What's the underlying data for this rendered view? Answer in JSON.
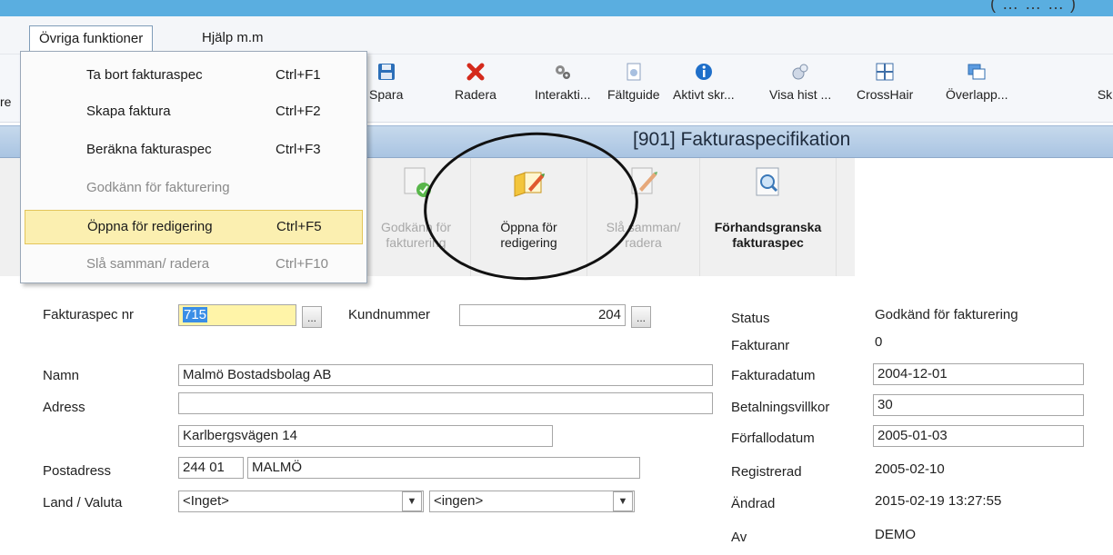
{
  "window_title": "[901]  Fakturaspecifikation",
  "titlebar_fragment": "( … … … )",
  "menubar": {
    "items": [
      "Övriga funktioner",
      "Hjälp m.m"
    ]
  },
  "dropdown": {
    "items": [
      {
        "label": "Ta bort fakturaspec",
        "shortcut": "Ctrl+F1"
      },
      {
        "label": "Skapa faktura",
        "shortcut": "Ctrl+F2"
      },
      {
        "label": "Beräkna fakturaspec",
        "shortcut": "Ctrl+F3"
      },
      {
        "label": "Godkänn för fakturering",
        "shortcut": ""
      },
      {
        "label": "Öppna för redigering",
        "shortcut": "Ctrl+F5"
      },
      {
        "label": "Slå samman/ radera",
        "shortcut": "Ctrl+F10"
      }
    ]
  },
  "toolbar": {
    "items": [
      {
        "label": "Spara",
        "icon": "floppy-save-icon"
      },
      {
        "label": "Radera",
        "icon": "red-x-delete-icon"
      },
      {
        "label": "Interakti...",
        "icon": "gears-icon"
      },
      {
        "label": "Fältguide",
        "icon": "document-guide-icon"
      },
      {
        "label": "Aktivt skr...",
        "icon": "info-icon"
      },
      {
        "label": "Visa hist ...",
        "icon": "history-icon"
      },
      {
        "label": "CrossHair",
        "icon": "crosshair-grid-icon"
      },
      {
        "label": "Överlapp...",
        "icon": "overlap-windows-icon"
      },
      {
        "label": "Sk",
        "icon": "generic-icon"
      }
    ],
    "left_fragment": "re"
  },
  "actions": [
    {
      "label_1": "Godkänn för",
      "label_2": "fakturering",
      "enabled": false
    },
    {
      "label_1": "Öppna för",
      "label_2": "redigering",
      "enabled": true
    },
    {
      "label_1": "Slå samman/",
      "label_2": "radera",
      "enabled": false
    },
    {
      "label_1": "Förhandsgranska",
      "label_2": "fakturaspec",
      "enabled": true
    }
  ],
  "form": {
    "fakturaspec_nr_label": "Fakturaspec nr",
    "fakturaspec_nr": "715",
    "kundnummer_label": "Kundnummer",
    "kundnummer": "204",
    "namn_label": "Namn",
    "namn": "Malmö Bostadsbolag AB",
    "adress_label": "Adress",
    "adress_1": "",
    "adress_2": "Karlbergsvägen 14",
    "postadress_label": "Postadress",
    "postnummer": "244 01",
    "ort": "MALMÖ",
    "land_valuta_label": "Land / Valuta",
    "land": "<Inget>",
    "valuta": "<ingen>"
  },
  "status_panel": {
    "status_label": "Status",
    "status": "Godkänd för fakturering",
    "fakturanr_label": "Fakturanr",
    "fakturanr": "0",
    "fakturadatum_label": "Fakturadatum",
    "fakturadatum": "2004-12-01",
    "betalningsvillkor_label": "Betalningsvillkor",
    "betalningsvillkor": "30",
    "forfallodatum_label": "Förfallodatum",
    "forfallodatum": "2005-01-03",
    "registrerad_label": "Registrerad",
    "registrerad": "2005-02-10",
    "andrad_label": "Ändrad",
    "andrad": "2015-02-19 13:27:55",
    "av_label": "Av",
    "av": "DEMO"
  },
  "colors": {
    "title_strip": "#5aaee0",
    "header_gradient": "#b3cbe6",
    "highlight": "#fbefb0",
    "field_highlight": "#fff4a8",
    "selection": "#3a8ee6"
  }
}
